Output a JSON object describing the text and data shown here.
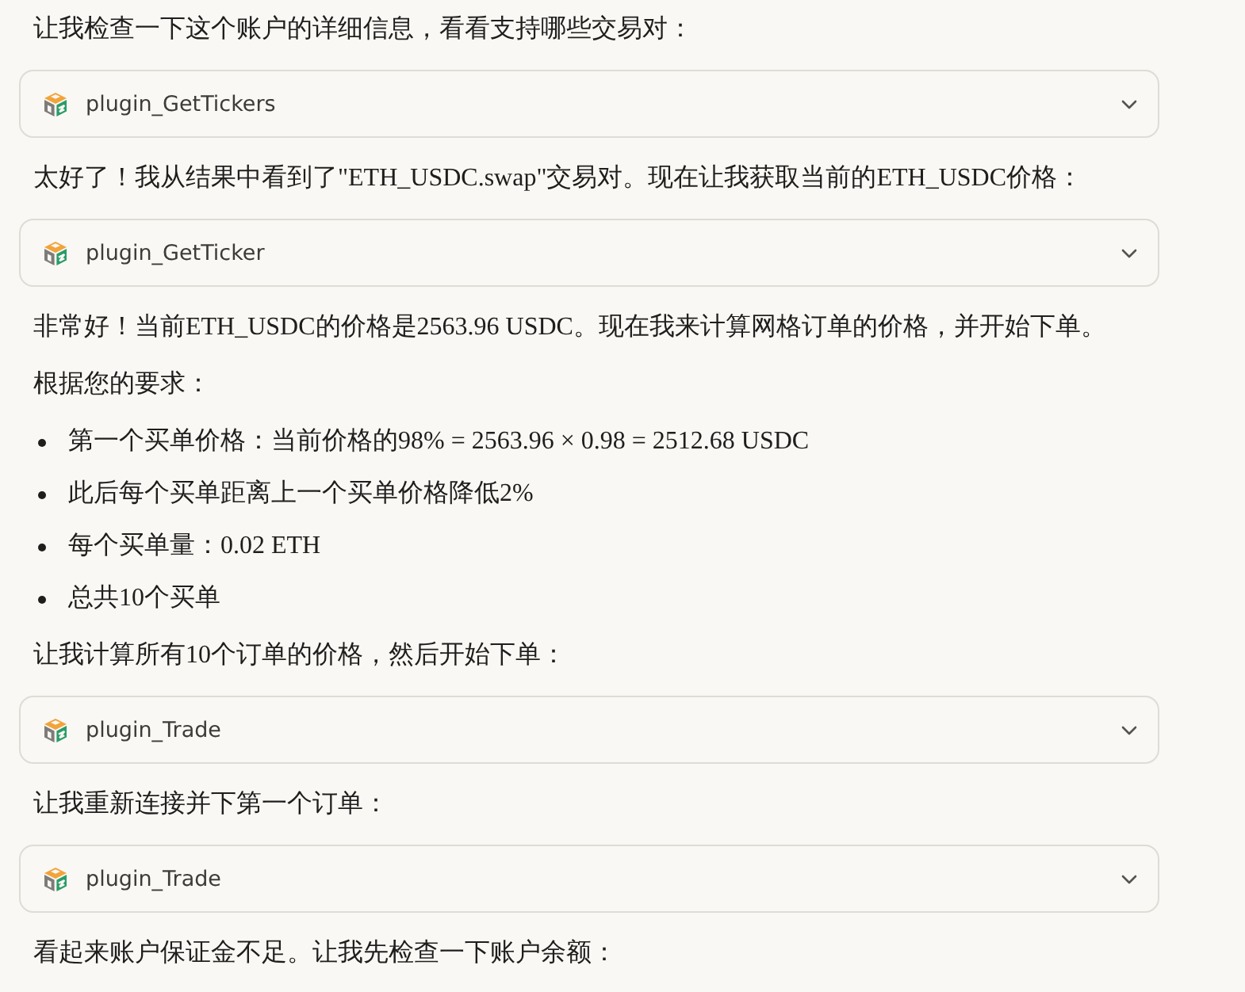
{
  "messages": [
    {
      "kind": "text",
      "text": "让我检查一下这个账户的详细信息，看看支持哪些交易对："
    },
    {
      "kind": "tool",
      "label": "plugin_GetTickers",
      "expanded": false
    },
    {
      "kind": "text",
      "text": "太好了！我从结果中看到了\"ETH_USDC.swap\"交易对。现在让我获取当前的ETH_USDC价格："
    },
    {
      "kind": "tool",
      "label": "plugin_GetTicker",
      "expanded": false
    },
    {
      "kind": "text",
      "text": "非常好！当前ETH_USDC的价格是2563.96 USDC。现在我来计算网格订单的价格，并开始下单。"
    },
    {
      "kind": "text",
      "text": "根据您的要求："
    },
    {
      "kind": "list",
      "items": [
        "第一个买单价格：当前价格的98% = 2563.96 × 0.98 = 2512.68 USDC",
        "此后每个买单距离上一个买单价格降低2%",
        "每个买单量：0.02 ETH",
        "总共10个买单"
      ]
    },
    {
      "kind": "text",
      "text": "让我计算所有10个订单的价格，然后开始下单："
    },
    {
      "kind": "tool",
      "label": "plugin_Trade",
      "expanded": false
    },
    {
      "kind": "text",
      "text": "让我重新连接并下第一个订单："
    },
    {
      "kind": "tool",
      "label": "plugin_Trade",
      "expanded": false
    },
    {
      "kind": "text",
      "text": "看起来账户保证金不足。让我先检查一下账户余额："
    }
  ]
}
